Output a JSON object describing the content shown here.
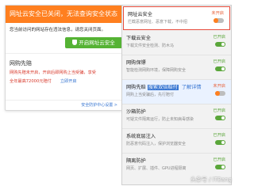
{
  "popup": {
    "header_title": "网址云安全已关闭，无法查询安全状态",
    "message": "您当前访问的网站存在违法信息，请您关闭页面。",
    "open_button_label": "开启网址云安全",
    "sub_title": "网购先赔",
    "warning_line1": "网购先赔未开启，开启后即网购上当受骗，享受",
    "warning_line2": "全年最高72000元赔付",
    "link_label": "立即开启",
    "footer_link": "安全防护中心设置 >"
  },
  "panel": {
    "items": [
      {
        "title": "网址云安全",
        "desc": "拦截恶意网址、恶意下载，不中招",
        "status": "未开启",
        "enabled": false
      },
      {
        "title": "下载云安全",
        "desc": "下载文件安全检测、防木马",
        "status": "已开启",
        "enabled": true
      },
      {
        "title": "网购保镖",
        "desc": "智能检测网购环境，保障网购安全",
        "status": "已开启",
        "enabled": true
      },
      {
        "title": "网购先赔",
        "tag": "搜索双倍赔付",
        "link": "了解详情",
        "desc": "网购上当受骗后，先行赔付",
        "status": "未开启",
        "enabled": false
      },
      {
        "title": "沙箱防护",
        "desc": "可疑文件隔离运行，防止未知病毒感染",
        "status": "已开启",
        "enabled": true
      },
      {
        "title": "系统底层注入",
        "desc": "防恶意代码注入，保护浏览器安全",
        "status": "已开启",
        "enabled": true
      },
      {
        "title": "隔离防护",
        "desc": "网页、扩展、插件、GPU进程隔离",
        "status": "已开启",
        "enabled": true
      }
    ]
  },
  "watermark": "头条号 / ITBang",
  "colors": {
    "accent": "#ff7f1f",
    "green": "#5aa63a",
    "red": "#e64b3b",
    "link": "#3574d1"
  }
}
